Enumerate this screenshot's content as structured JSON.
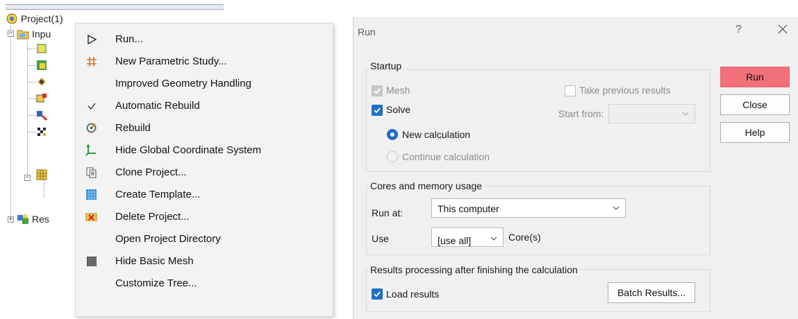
{
  "tree": {
    "root_label": "Project(1)",
    "input_label": "Inpu",
    "results_label": "Res"
  },
  "context_menu": {
    "items": [
      {
        "label": "Run...",
        "icon": "play-icon"
      },
      {
        "label": "New Parametric Study...",
        "icon": "grid-icon"
      },
      {
        "label": "Improved Geometry Handling",
        "icon": ""
      },
      {
        "label": "Automatic Rebuild",
        "icon": "checkmark-icon"
      },
      {
        "label": "Rebuild",
        "icon": "rebuild-icon"
      },
      {
        "label": "Hide Global Coordinate System",
        "icon": "axes-icon"
      },
      {
        "label": "Clone Project...",
        "icon": "copy-icon"
      },
      {
        "label": "Create Template...",
        "icon": "template-icon"
      },
      {
        "label": "Delete Project...",
        "icon": "delete-icon"
      },
      {
        "label": "Open Project Directory",
        "icon": ""
      },
      {
        "label": "Hide Basic Mesh",
        "icon": "mesh-icon"
      },
      {
        "label": "Customize Tree...",
        "icon": ""
      }
    ]
  },
  "dialog": {
    "title": "Run",
    "help_glyph": "?",
    "startup": {
      "title": "Startup",
      "mesh_label": "Mesh",
      "take_previous_label": "Take previous results",
      "solve_label": "Solve",
      "start_from_label": "Start from:",
      "start_from_value": "",
      "new_calc_label": "New calculation",
      "continue_calc_label": "Continue calculation"
    },
    "cores": {
      "title": "Cores and memory usage",
      "run_at_label": "Run at:",
      "run_at_value": "This computer",
      "use_label": "Use",
      "use_value": "[use all]",
      "cores_suffix": "Core(s)"
    },
    "results": {
      "title": "Results processing after finishing the calculation",
      "load_results_label": "Load results",
      "batch_button": "Batch Results..."
    },
    "buttons": {
      "run": "Run",
      "close": "Close",
      "help": "Help"
    },
    "colors": {
      "primary_button": "#f1707a",
      "accent": "#1f6fc6"
    }
  }
}
